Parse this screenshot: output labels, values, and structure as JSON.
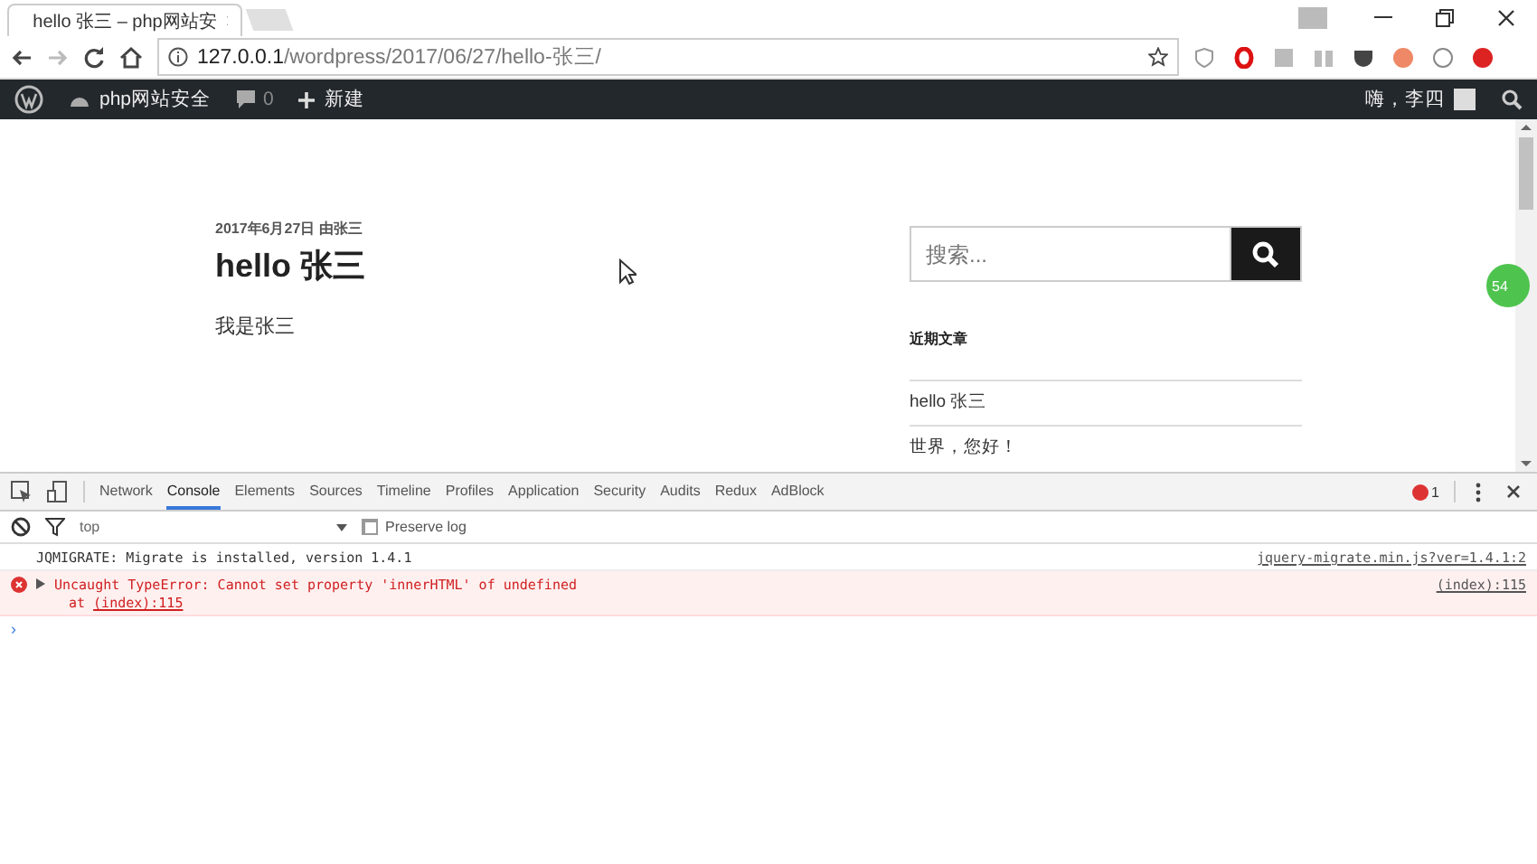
{
  "browser": {
    "tab_title": "hello 张三 – php网站安",
    "url_host": "127.0.0.1",
    "url_path": "/wordpress/2017/06/27/hello-张三/"
  },
  "admin_bar": {
    "site_name": "php网站安全",
    "comments_count": "0",
    "new_label": "新建",
    "greeting": "嗨，李四"
  },
  "post": {
    "meta": "2017年6月27日 由张三",
    "title": "hello 张三",
    "body": "我是张三"
  },
  "sidebar": {
    "search_placeholder": "搜索...",
    "recent_heading": "近期文章",
    "recent_posts": [
      "hello 张三",
      "世界，您好！"
    ]
  },
  "floating_badge": "54",
  "devtools": {
    "tabs": [
      {
        "label": "Network",
        "selected": false
      },
      {
        "label": "Console",
        "selected": true
      },
      {
        "label": "Elements",
        "selected": false
      },
      {
        "label": "Sources",
        "selected": false
      },
      {
        "label": "Timeline",
        "selected": false
      },
      {
        "label": "Profiles",
        "selected": false
      },
      {
        "label": "Application",
        "selected": false
      },
      {
        "label": "Security",
        "selected": false
      },
      {
        "label": "Audits",
        "selected": false
      },
      {
        "label": "Redux",
        "selected": false
      },
      {
        "label": "AdBlock",
        "selected": false
      }
    ],
    "error_count": "1",
    "context": "top",
    "preserve_log": {
      "label": "Preserve log",
      "checked": false
    },
    "messages": [
      {
        "kind": "log",
        "text": "JQMIGRATE: Migrate is installed, version 1.4.1",
        "source": "jquery-migrate.min.js?ver=1.4.1:2"
      },
      {
        "kind": "error",
        "text": "Uncaught TypeError: Cannot set property 'innerHTML' of undefined",
        "at": "at",
        "at_link": "(index):115",
        "source": "(index):115"
      }
    ],
    "prompt": "›"
  }
}
